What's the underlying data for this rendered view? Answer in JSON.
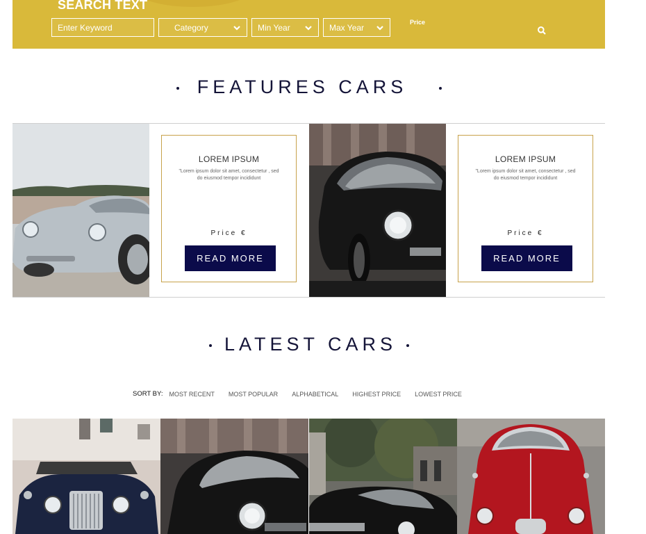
{
  "search": {
    "title": "SEARCH TEXT",
    "keyword_placeholder": "Enter Keyword",
    "category_value": "Category",
    "min_year_value": "Min Year",
    "max_year_value": "Max Year",
    "price_label": "Price",
    "search_icon": "search-icon",
    "band_color": "#d9b93a"
  },
  "features": {
    "title": "FEATURES CARS",
    "cards": [
      {
        "heading": "LOREM IPSUM",
        "text": "\"Lorem ipsum dolor sit amet, consectetur , sed do eiusmod tempor incididunt",
        "price": "Price €",
        "button": "READ MORE"
      },
      {
        "heading": "LOREM IPSUM",
        "text": "\"Lorem ipsum dolor sit amet, consectetur , sed do eiusmod tempor incididunt",
        "price": "Price €",
        "button": "READ MORE"
      }
    ],
    "accent_color": "#c7a24a",
    "button_color": "#0b0b4a"
  },
  "latest": {
    "title": "LATEST CARS",
    "sort_label": "SORT BY:",
    "sort_options": [
      "MOST RECENT",
      "MOST POPULAR",
      "ALPHABETICAL",
      "HIGHEST PRICE",
      "LOWEST PRICE"
    ]
  }
}
